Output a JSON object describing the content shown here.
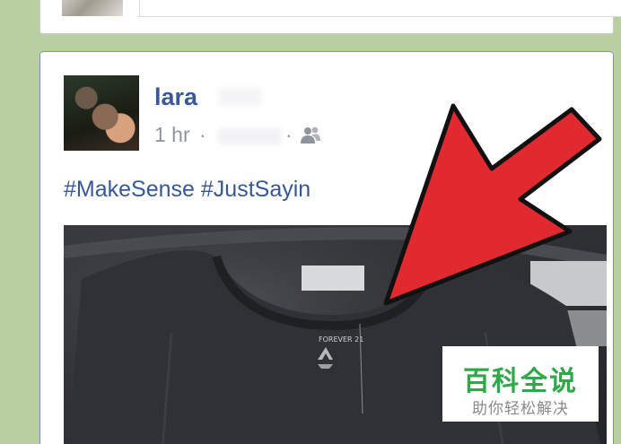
{
  "post": {
    "author_name": "lara",
    "time": "1 hr",
    "separator": "·",
    "privacy_icon": "friends-icon",
    "hashtags": [
      "#MakeSense",
      "#JustSayin"
    ],
    "photo_label": "FOREVER 21"
  },
  "watermark": {
    "title": "百科全说",
    "subtitle": "助你轻松解决"
  },
  "colors": {
    "background": "#b9cfa1",
    "link_blue": "#3b5998",
    "meta_gray": "#90949c",
    "arrow_red": "#e02a2f",
    "watermark_green": "#2fa84a"
  }
}
